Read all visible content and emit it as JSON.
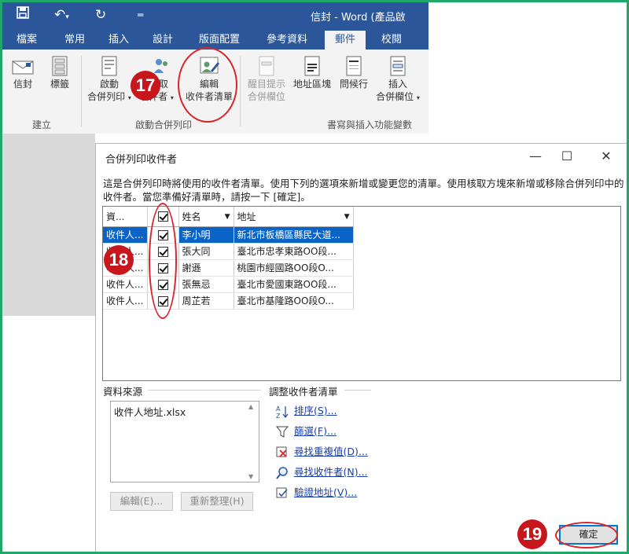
{
  "word": {
    "title": "信封 - Word (產品啟",
    "tabs": [
      "檔案",
      "常用",
      "插入",
      "設計",
      "版面配置",
      "參考資料",
      "郵件",
      "校閱"
    ],
    "active_tab": "郵件",
    "buttons": {
      "envelope": "信封",
      "labels": "標籤",
      "start_merge_1": "啟動",
      "start_merge_2": "合併列印",
      "select_recipients_1": "取",
      "select_recipients_2": "收件者",
      "edit_recipients_1": "編輯",
      "edit_recipients_2": "收件者清單",
      "highlight_1": "醒目提示",
      "highlight_2": "合併欄位",
      "address_block": "地址區塊",
      "greeting_line": "問候行",
      "insert_field_1": "插入",
      "insert_field_2": "合併欄位"
    },
    "groups": {
      "create": "建立",
      "start_merge": "啟動合併列印",
      "write_insert": "書寫與插入功能變數"
    }
  },
  "dialog": {
    "title": "合併列印收件者",
    "description": "這是合併列印時將使用的收件者清單。使用下列的選項來新增或變更您的清單。使用核取方塊來新增或移除合併列印中的收件者。當您準備好清單時，請按一下 [確定]。",
    "columns": [
      "資...",
      "",
      "姓名",
      "地址"
    ],
    "rows": [
      {
        "source": "收件人...",
        "name": "李小明",
        "address": "新北市板橋區縣民大道..."
      },
      {
        "source": "收件人...",
        "name": "張大同",
        "address": "臺北市忠孝東路OO段..."
      },
      {
        "source": "收件人...",
        "name": "謝遜",
        "address": "桃園市經國路OO段O..."
      },
      {
        "source": "收件人...",
        "name": "張無忌",
        "address": "臺北市愛國東路OO段..."
      },
      {
        "source": "收件人...",
        "name": "周芷若",
        "address": "臺北市基隆路OO段O..."
      }
    ],
    "data_source_label": "資料來源",
    "data_source_file": "收件人地址.xlsx",
    "edit_button": "編輯(E)...",
    "refresh_button": "重新整理(H)",
    "adjust_label": "調整收件者清單",
    "links": [
      "排序(S)...",
      "篩選(F)...",
      "尋找重複值(D)...",
      "尋找收件者(N)...",
      "驗證地址(V)..."
    ],
    "ok_button": "確定"
  },
  "annotations": [
    "17",
    "18",
    "19"
  ],
  "colors": {
    "word_blue": "#2b579a",
    "selection": "#0a64c8",
    "annotation_red": "#c8161d",
    "frame_green": "#1fa86a"
  }
}
